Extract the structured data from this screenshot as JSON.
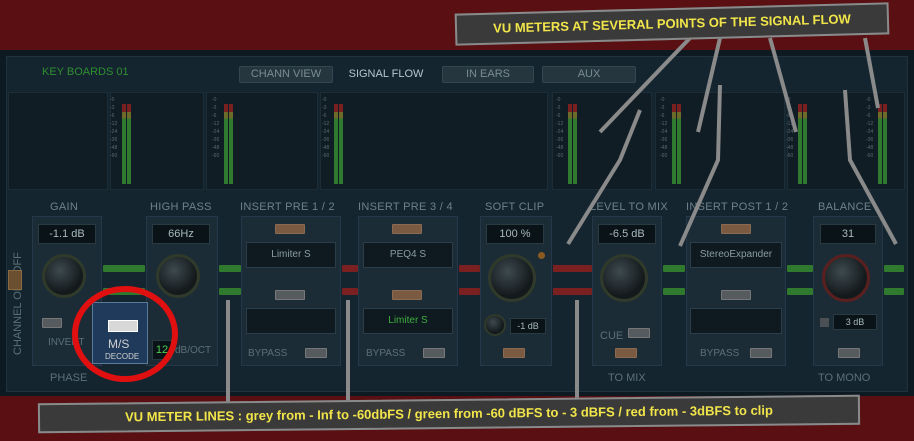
{
  "header": {
    "channel_name": "KEY BOARDS 01"
  },
  "tabs": [
    {
      "label": "CHANN VIEW"
    },
    {
      "label": "SIGNAL FLOW"
    },
    {
      "label": "IN EARS"
    },
    {
      "label": "AUX"
    }
  ],
  "side": {
    "label": "CHANNEL ON / OFF"
  },
  "sections": {
    "gain": {
      "title": "GAIN",
      "value": "-1.1 dB",
      "invert": "INVERT",
      "phase": "PHASE"
    },
    "highpass": {
      "title": "HIGH PASS",
      "value": "66Hz",
      "order": "12",
      "slope": "dB/OCT"
    },
    "ms": {
      "label": "M/S",
      "sub": "DECODE"
    },
    "insert_pre_12": {
      "title": "INSERT PRE 1 / 2",
      "slot1": "Limiter S",
      "slot2": ""
    },
    "insert_pre_34": {
      "title": "INSERT PRE 3 / 4",
      "slot1": "PEQ4 S",
      "slot2": "Limiter S"
    },
    "softclip": {
      "title": "SOFT CLIP",
      "value": "100 %",
      "small_value": "-1 dB"
    },
    "level": {
      "title": "LEVEL TO MIX",
      "value": "-6.5 dB",
      "cue": "CUE",
      "to_mix": "TO MIX"
    },
    "insert_post": {
      "title": "INSERT POST 1 / 2",
      "slot1": "StereoExpander",
      "slot2": ""
    },
    "balance": {
      "title": "BALANCE",
      "value": "31",
      "small_value": "3 dB",
      "to_mono": "TO MONO"
    },
    "bypass": "BYPASS"
  },
  "annotations": {
    "top": "VU METERS AT SEVERAL POINTS OF THE SIGNAL FLOW",
    "bottom": "VU METER LINES : grey from - Inf to -60dbFS / green from -60 dBFS to - 3 dBFS / red from - 3dBFS to clip"
  },
  "colors": {
    "annotation_text": "#f1e54a",
    "highlight_circle": "#e01010",
    "background": "#5a0f12"
  }
}
